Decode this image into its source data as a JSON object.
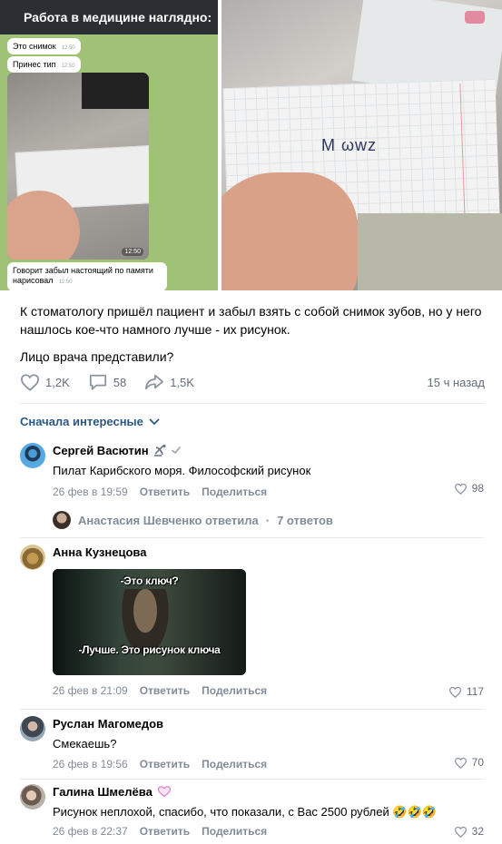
{
  "images": {
    "left": {
      "header": "Работа в медицине наглядно:",
      "bubbles": [
        {
          "text": "Это снимок",
          "time": "12:50"
        },
        {
          "text": "Принес тип",
          "time": "12:50"
        }
      ],
      "photo_time": "12:50",
      "last_bubble": {
        "text": "Говорит забыл настоящий по памяти нарисовал",
        "time": "12:50"
      }
    },
    "right": {
      "drawing": "M ωwz"
    }
  },
  "post": {
    "text1": "К стоматологу пришёл пациент и забыл взять с собой снимок зубов, но у него нашлось кое-что намного лучше - их рисунок.",
    "text2": "Лицо врача представили?"
  },
  "actions": {
    "likes": "1,2K",
    "comments": "58",
    "shares": "1,5K",
    "time_ago": "15 ч назад"
  },
  "sort_label": "Сначала интересные",
  "comments": [
    {
      "name": "Сергей Васютин",
      "text": "Пилат Карибского моря. Философский рисунок",
      "date": "26 фев в 19:59",
      "reply": "Ответить",
      "share": "Поделиться",
      "likes": "98"
    },
    {
      "name": "Анна Кузнецова",
      "text": "",
      "date": "26 фев в 21:09",
      "reply": "Ответить",
      "share": "Поделиться",
      "likes": "117",
      "meme": {
        "top": "-Это ключ?",
        "bottom": "-Лучше. Это рисунок ключа"
      }
    },
    {
      "name": "Руслан Магомедов",
      "text": "Смекаешь?",
      "date": "26 фев в 19:56",
      "reply": "Ответить",
      "share": "Поделиться",
      "likes": "70"
    },
    {
      "name": "Галина Шмелёва",
      "text": "Рисунок неплохой, спасибо, что показали, с Вас 2500 рублей 🤣🤣🤣",
      "date": "26 фев в 22:37",
      "reply": "Ответить",
      "share": "Поделиться",
      "likes": "32"
    }
  ],
  "thread": {
    "name": "Анастасия Шевченко ответила",
    "sep": "·",
    "count": "7 ответов"
  },
  "colors": {
    "link": "#2a5885",
    "secondary": "#818c99",
    "divider": "#e7e8ec"
  }
}
